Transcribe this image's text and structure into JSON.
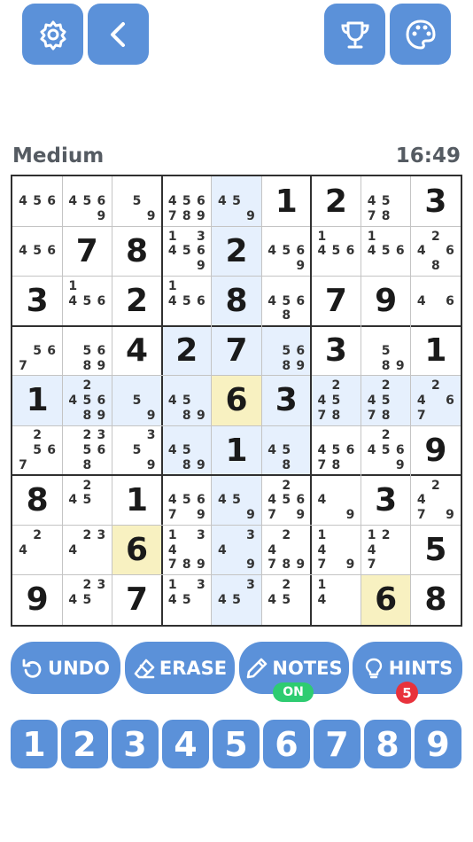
{
  "top_bar": {
    "left_icons": [
      "settings-gear-icon",
      "back-chevron-icon"
    ],
    "right_icons": [
      "trophy-icon",
      "palette-icon"
    ]
  },
  "difficulty": "Medium",
  "timer": "16:49",
  "colors": {
    "accent": "#5b91d9",
    "highlight_row_col_box": "#e6f0fd",
    "highlight_same_number": "#f8f1c1",
    "notes_on_badge": "#2ecc71",
    "hints_badge": "#e8323c"
  },
  "selected_cell": "row 5, column 5",
  "board": [
    [
      {
        "n": "456"
      },
      {
        "n": "4569"
      },
      {
        "n": "59"
      },
      {
        "n": "456789"
      },
      {
        "n": "459"
      },
      {
        "v": "1"
      },
      {
        "v": "2"
      },
      {
        "n": "4578"
      },
      {
        "v": "3"
      }
    ],
    [
      {
        "n": "456"
      },
      {
        "v": "7"
      },
      {
        "v": "8"
      },
      {
        "n": "134569"
      },
      {
        "v": "2"
      },
      {
        "n": "4569"
      },
      {
        "n": "1456"
      },
      {
        "n": "1456"
      },
      {
        "n": "2468"
      }
    ],
    [
      {
        "v": "3"
      },
      {
        "n": "1456"
      },
      {
        "v": "2"
      },
      {
        "n": "1456"
      },
      {
        "v": "8"
      },
      {
        "n": "4568"
      },
      {
        "v": "7"
      },
      {
        "v": "9"
      },
      {
        "n": "46"
      }
    ],
    [
      {
        "n": "567"
      },
      {
        "n": "5689"
      },
      {
        "v": "4"
      },
      {
        "v": "2"
      },
      {
        "v": "7"
      },
      {
        "n": "5689"
      },
      {
        "v": "3"
      },
      {
        "n": "589"
      },
      {
        "v": "1"
      }
    ],
    [
      {
        "v": "1"
      },
      {
        "n": "245689"
      },
      {
        "n": "59"
      },
      {
        "n": "4589"
      },
      {
        "v": "6"
      },
      {
        "v": "3"
      },
      {
        "n": "24578"
      },
      {
        "n": "24578"
      },
      {
        "n": "2467"
      }
    ],
    [
      {
        "n": "2567"
      },
      {
        "n": "23568"
      },
      {
        "n": "359"
      },
      {
        "n": "4589"
      },
      {
        "v": "1"
      },
      {
        "n": "458"
      },
      {
        "n": "45678"
      },
      {
        "n": "24569"
      },
      {
        "v": "9"
      }
    ],
    [
      {
        "v": "8"
      },
      {
        "n": "245"
      },
      {
        "v": "1"
      },
      {
        "n": "45679"
      },
      {
        "n": "459"
      },
      {
        "n": "245679"
      },
      {
        "n": "49"
      },
      {
        "v": "3"
      },
      {
        "n": "2479"
      }
    ],
    [
      {
        "n": "24"
      },
      {
        "n": "234"
      },
      {
        "v": "6"
      },
      {
        "n": "134789"
      },
      {
        "n": "349"
      },
      {
        "n": "24789"
      },
      {
        "n": "1479"
      },
      {
        "n": "1247"
      },
      {
        "v": "5"
      }
    ],
    [
      {
        "v": "9"
      },
      {
        "n": "2345"
      },
      {
        "v": "7"
      },
      {
        "n": "1345"
      },
      {
        "n": "345"
      },
      {
        "n": "245"
      },
      {
        "n": "14"
      },
      {
        "v": "6"
      },
      {
        "v": "8"
      }
    ]
  ],
  "actions": [
    {
      "label": "UNDO",
      "icon": "undo-icon"
    },
    {
      "label": "ERASE",
      "icon": "eraser-icon"
    },
    {
      "label": "NOTES",
      "icon": "pencil-icon"
    },
    {
      "label": "HINTS",
      "icon": "lightbulb-icon"
    }
  ],
  "notes_badge": "ON",
  "hints_badge": "5",
  "number_pad": [
    "1",
    "2",
    "3",
    "4",
    "5",
    "6",
    "7",
    "8",
    "9"
  ]
}
